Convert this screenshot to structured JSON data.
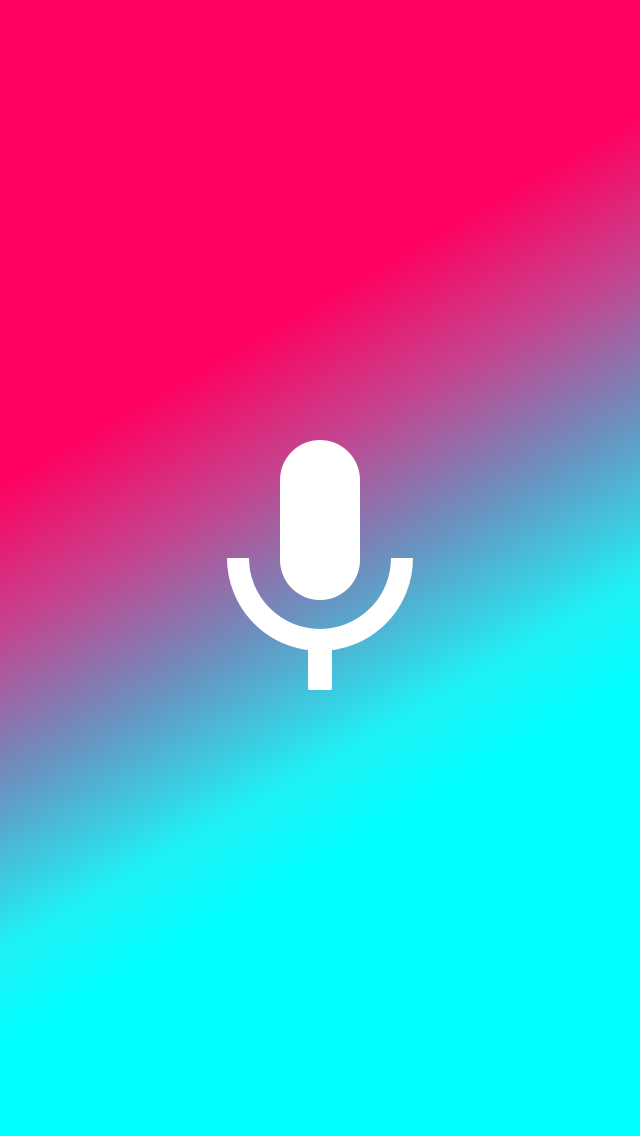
{
  "screen": {
    "name": "voice-input-screen",
    "background": {
      "type": "diagonal-gradient",
      "colors": [
        "#ff005f",
        "#00ffff"
      ]
    }
  },
  "mic": {
    "icon": "microphone-icon",
    "color": "#ffffff"
  }
}
